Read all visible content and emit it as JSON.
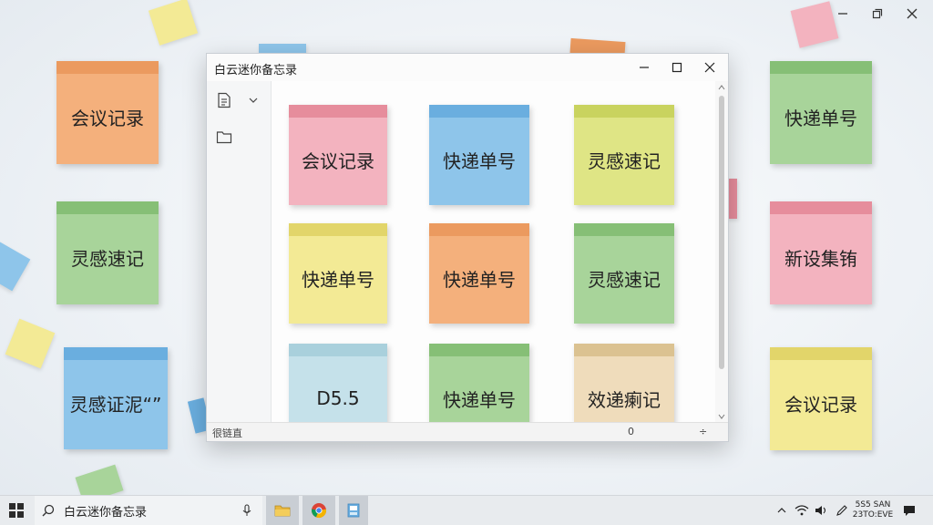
{
  "window": {
    "title": "白云迷你备忘录",
    "status_left": "很链直",
    "status_mid": "0",
    "status_right": "÷"
  },
  "colors": {
    "orange": "#f4b07c",
    "orange_band": "#eb9a5f",
    "green": "#a8d49a",
    "green_band": "#86bf76",
    "blue": "#8ec5ea",
    "blue_band": "#6aaedf",
    "pink": "#f3b3bf",
    "pink_band": "#e68d9c",
    "yellow": "#f3ea95",
    "yellow_band": "#e2d56a",
    "lime": "#dfe585",
    "lime_band": "#c9d35f",
    "lightblue": "#c5e1ea",
    "lightblue_band": "#a9d0dc",
    "beige": "#efdcbb",
    "beige_band": "#dbc291"
  },
  "desktop_notes": [
    {
      "text": "会议记录",
      "color": "orange"
    },
    {
      "text": "灵感速记",
      "color": "green"
    },
    {
      "text": "灵感证泥“”",
      "color": "blue"
    },
    {
      "text": "快递单号",
      "color": "green"
    },
    {
      "text": "新设集铕",
      "color": "pink"
    },
    {
      "text": "会议记录",
      "color": "yellow"
    }
  ],
  "app_notes": [
    {
      "text": "会议记录",
      "color": "pink"
    },
    {
      "text": "快递单号",
      "color": "blue"
    },
    {
      "text": "灵感速记",
      "color": "lime"
    },
    {
      "text": "快递单号",
      "color": "yellow"
    },
    {
      "text": "快递单号",
      "color": "orange"
    },
    {
      "text": "灵感速记",
      "color": "green"
    },
    {
      "text": "D5.5",
      "color": "lightblue"
    },
    {
      "text": "快递单号",
      "color": "green"
    },
    {
      "text": "效递瘌记",
      "color": "beige"
    }
  ],
  "taskbar": {
    "search_text": "白云迷你备忘录",
    "clock_time": "5S5 SAN",
    "clock_date": "23TO:EVE"
  },
  "icons": {
    "start": "windows-start-icon",
    "search": "search-icon",
    "mic": "microphone-icon",
    "explorer": "folder-icon",
    "browser": "chrome-icon",
    "app": "notes-app-icon"
  }
}
